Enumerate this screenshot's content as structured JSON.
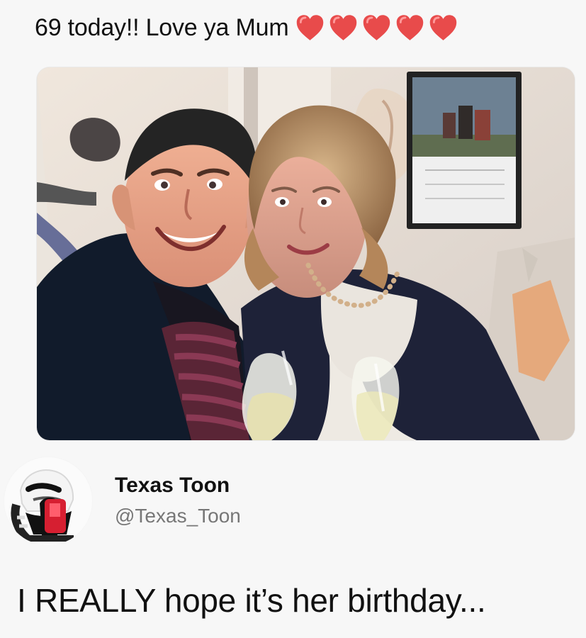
{
  "caption": {
    "text": "69 today!! Love ya Mum",
    "hearts": [
      {
        "icon": "red-heart-icon",
        "color": "#e84b4b"
      },
      {
        "icon": "red-heart-icon",
        "color": "#e84b4b"
      },
      {
        "icon": "red-heart-icon",
        "color": "#e84b4b"
      },
      {
        "icon": "red-heart-icon",
        "color": "#e84b4b"
      },
      {
        "icon": "red-heart-icon",
        "color": "#e84b4b"
      }
    ]
  },
  "photo": {
    "icon": "selfie-photo"
  },
  "profile": {
    "avatar_icon": "stormtrooper-avatar-icon",
    "display_name": "Texas Toon",
    "handle": "@Texas_Toon"
  },
  "post": {
    "text": "I REALLY hope it’s her birthday..."
  },
  "colors": {
    "background": "#f7f7f7",
    "text": "#111111",
    "handle_text": "#777777",
    "heart": "#e84b4b"
  }
}
